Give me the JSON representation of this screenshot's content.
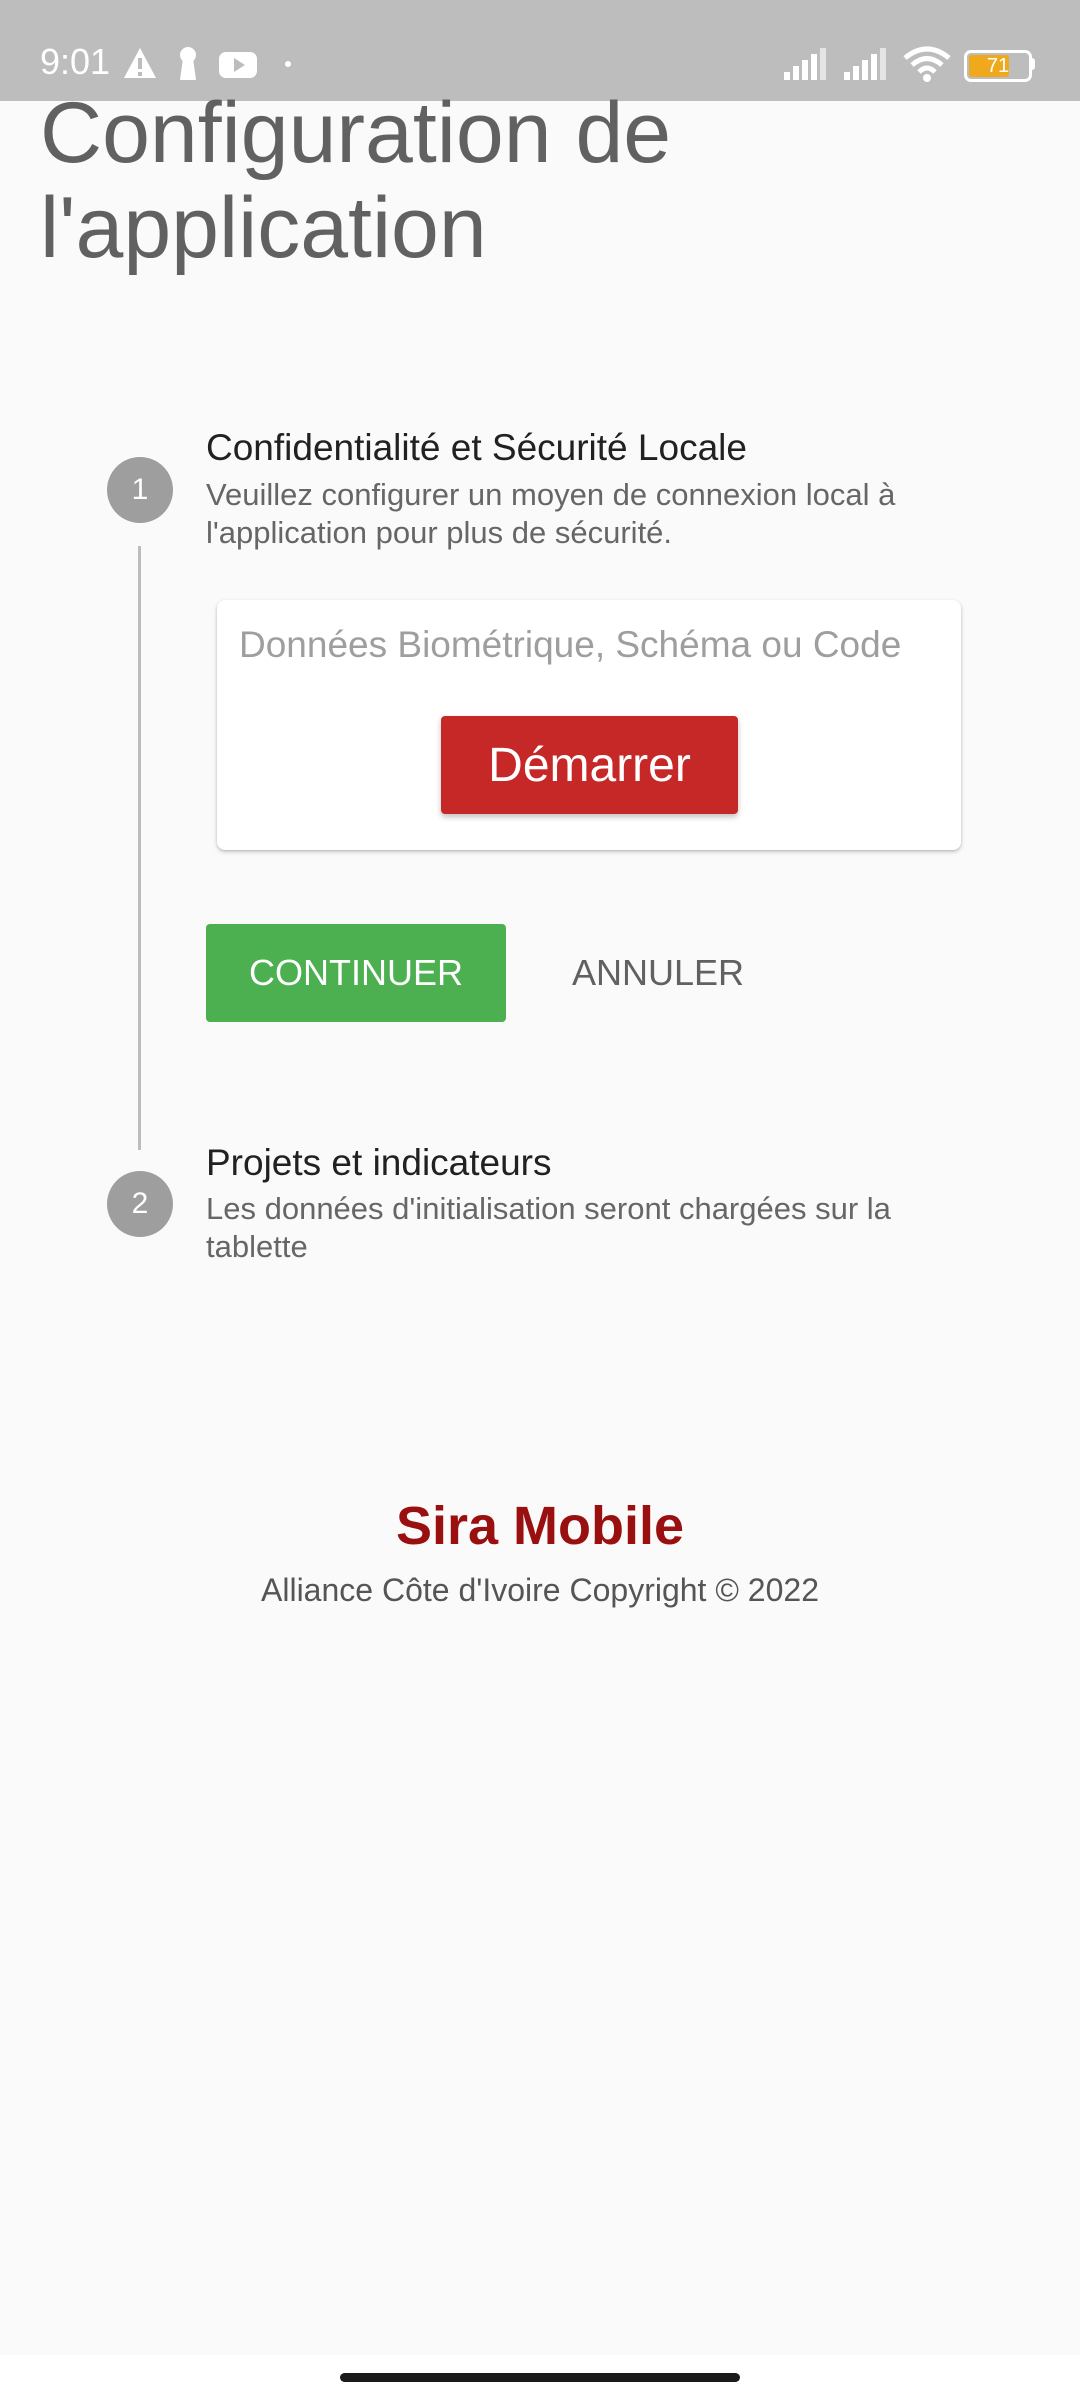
{
  "status_bar": {
    "time": "9:01",
    "battery_level": "71",
    "icons": [
      "warning-icon",
      "keyhole-icon",
      "youtube-icon",
      "dot-icon",
      "signal-icon",
      "signal-icon",
      "wifi-icon",
      "battery-icon"
    ],
    "battery_color": "#f0a81c"
  },
  "page": {
    "title": "Configuration de l'application"
  },
  "steps": [
    {
      "number": "1",
      "title": "Confidentialité et Sécurité Locale",
      "description": "Veuillez configurer un moyen de connexion local à l'application pour plus de sécurité."
    },
    {
      "number": "2",
      "title": "Projets et indicateurs",
      "description": "Les données d'initialisation seront chargées sur la tablette"
    }
  ],
  "card": {
    "hint": "Données Biométrique, Schéma ou Code",
    "start_label": "Démarrer"
  },
  "actions": {
    "continue_label": "CONTINUER",
    "cancel_label": "ANNULER"
  },
  "footer": {
    "app_name": "Sira Mobile",
    "copyright": "Alliance Côte d'Ivoire Copyright © 2022"
  },
  "colors": {
    "start_button": "#c62828",
    "continue_button": "#4caf50",
    "brand": "#9a1010"
  }
}
